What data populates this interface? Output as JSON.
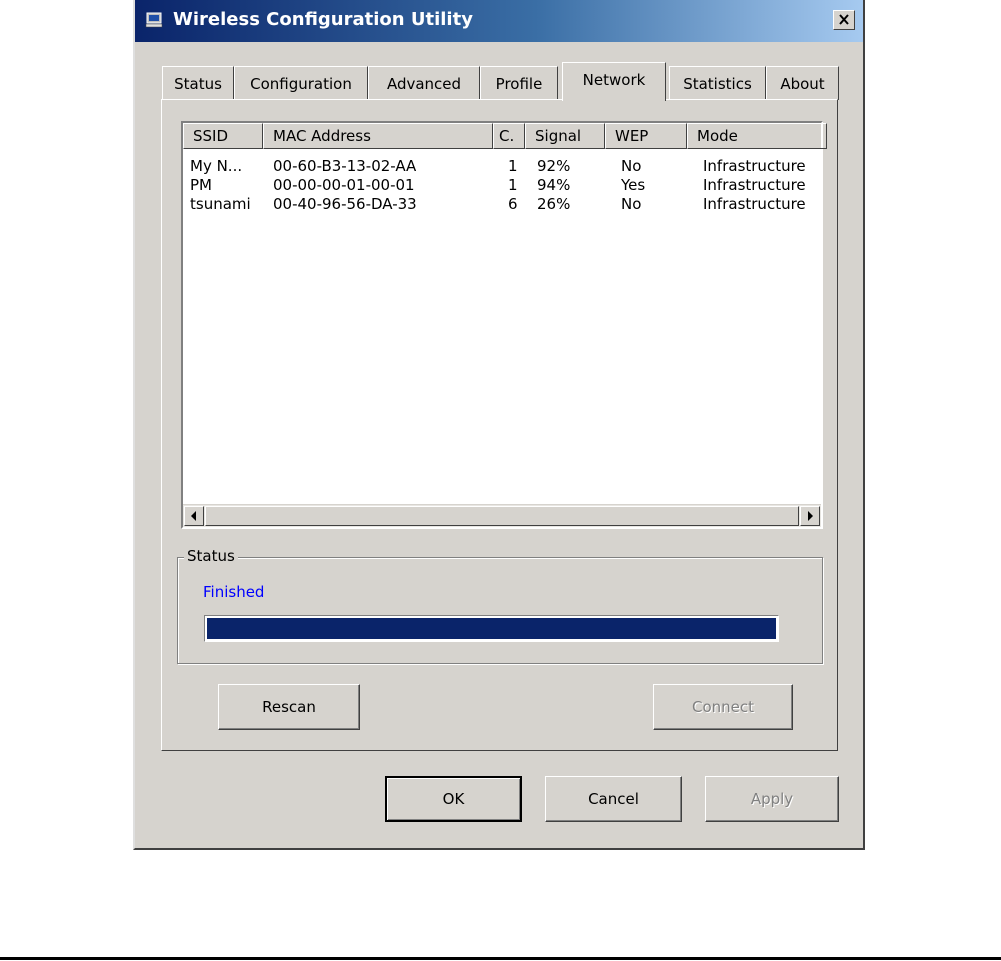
{
  "window": {
    "title": "Wireless Configuration Utility",
    "close_icon": "close-icon",
    "app_icon": "network-computer-icon"
  },
  "tabs": [
    {
      "label": "Status",
      "active": false
    },
    {
      "label": "Configuration",
      "active": false
    },
    {
      "label": "Advanced",
      "active": false
    },
    {
      "label": "Profile",
      "active": false
    },
    {
      "label": "Network",
      "active": true
    },
    {
      "label": "Statistics",
      "active": false
    },
    {
      "label": "About",
      "active": false
    }
  ],
  "network_list": {
    "columns": [
      "SSID",
      "MAC Address",
      "C.",
      "Signal",
      "WEP",
      "Mode"
    ],
    "rows": [
      [
        "My N...",
        "00-60-B3-13-02-AA",
        "1",
        "92%",
        "No",
        "Infrastructure"
      ],
      [
        "PM",
        "00-00-00-01-00-01",
        "1",
        "94%",
        "Yes",
        "Infrastructure"
      ],
      [
        "tsunami",
        "00-40-96-56-DA-33",
        "6",
        "26%",
        "No",
        "Infrastructure"
      ]
    ]
  },
  "status_group": {
    "label": "Status",
    "text": "Finished",
    "progress_percent": 100
  },
  "buttons": {
    "rescan": "Rescan",
    "connect": "Connect",
    "ok": "OK",
    "cancel": "Cancel",
    "apply": "Apply"
  },
  "colors": {
    "title_bar": "#0a246a",
    "status_text": "#0000ff",
    "progress_fill": "#0a246a",
    "face": "#d6d3ce"
  }
}
